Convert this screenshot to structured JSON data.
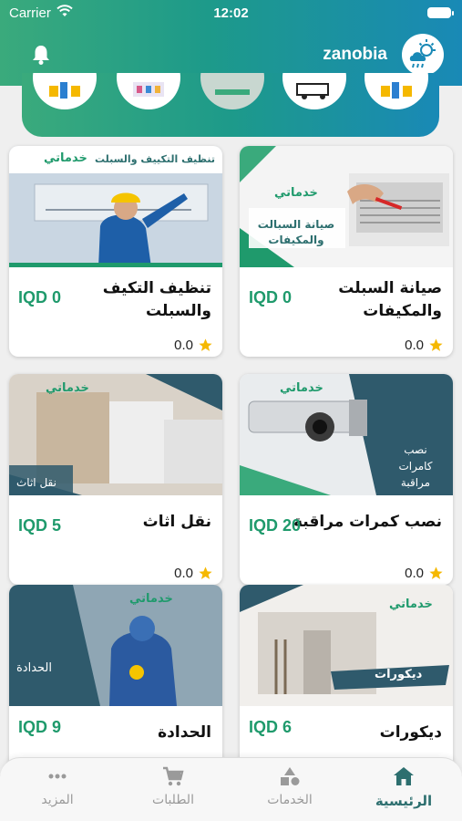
{
  "status_bar": {
    "carrier": "Carrier",
    "time": "12:02"
  },
  "header": {
    "username": "zanobia",
    "icons": [
      "bell-icon",
      "weather-icon"
    ]
  },
  "colors": {
    "brand_green": "#1f9a6c",
    "accent_teal": "#2d6f6f",
    "header_start": "#3aaa7c",
    "header_end": "#1989b6",
    "star": "#f5b800"
  },
  "categories_strip": {
    "count_visible": 5
  },
  "services": [
    {
      "name": "صيانة السبلت والمكيفات",
      "price": "IQD 0",
      "rating": "0.0",
      "banner": "صيانة السبالت والمكيفات",
      "brand": "خدماتي"
    },
    {
      "name": "تنظيف التكيف والسبلت",
      "price": "IQD 0",
      "rating": "0.0",
      "banner": "تنظيف التكييف والسبلت",
      "brand": "خدماتي"
    },
    {
      "name": "نصب كمرات مراقبة",
      "price": "IQD 20",
      "rating": "0.0",
      "banner": "نصب كامرات مراقبة",
      "brand": "خدماتي"
    },
    {
      "name": "نقل اثاث",
      "price": "IQD 5",
      "rating": "0.0",
      "banner": "نقل اثاث",
      "brand": "خدماتي"
    },
    {
      "name": "ديكورات",
      "price": "IQD 6",
      "rating": "",
      "banner": "ديكورات",
      "brand": "خدماتي"
    },
    {
      "name": "الحدادة",
      "price": "IQD 9",
      "rating": "",
      "banner": "الحدادة",
      "brand": "خدماتي"
    }
  ],
  "tabs": [
    {
      "label": "الرئيسية",
      "icon": "home-icon",
      "active": true
    },
    {
      "label": "الخدمات",
      "icon": "shapes-icon",
      "active": false
    },
    {
      "label": "الطلبات",
      "icon": "cart-icon",
      "active": false
    },
    {
      "label": "المزيد",
      "icon": "more-icon",
      "active": false
    }
  ]
}
